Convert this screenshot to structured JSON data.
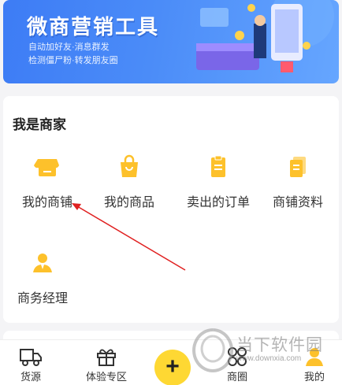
{
  "banner": {
    "title": "微商营销工具",
    "line1": "自动加好友·消息群发",
    "line2": "检测僵尸粉·转发朋友圈"
  },
  "merchant": {
    "section_title": "我是商家",
    "items": [
      {
        "label": "我的商铺",
        "icon": "shop-icon"
      },
      {
        "label": "我的商品",
        "icon": "shopping-bag-icon"
      },
      {
        "label": "卖出的订单",
        "icon": "clipboard-icon"
      },
      {
        "label": "商铺资料",
        "icon": "documents-icon"
      },
      {
        "label": "商务经理",
        "icon": "manager-icon"
      }
    ]
  },
  "nav": {
    "items": [
      {
        "label": "货源",
        "icon": "truck-icon"
      },
      {
        "label": "体验专区",
        "icon": "gift-icon"
      },
      {
        "label": "+",
        "icon": "plus-icon"
      },
      {
        "label": "商圈",
        "icon": "circles-icon"
      },
      {
        "label": "我的",
        "icon": "person-icon"
      }
    ]
  },
  "watermark": {
    "text": "当下软件园",
    "url": "www.downxia.com"
  },
  "colors": {
    "accent": "#fdc12b",
    "banner": "#4b8cf8",
    "fab": "#fed833",
    "annotation": "#e02020"
  }
}
